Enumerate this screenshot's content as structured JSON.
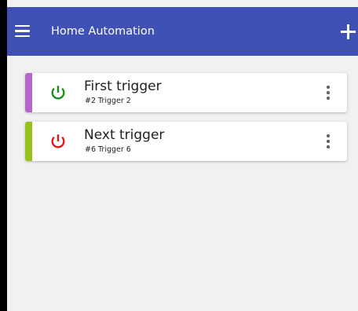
{
  "app": {
    "title": "Home Automation",
    "menu_icon": "hamburger-menu-icon",
    "add_icon": "plus-icon",
    "bar_color": "#3f51b5",
    "background_color": "#f1f1f1"
  },
  "triggers": [
    {
      "name": "First trigger",
      "subtitle": "#2 Trigger 2",
      "accent_color": "#b665c8",
      "power_state": "on",
      "power_icon": "power-icon",
      "power_color": "#1e8c1e",
      "more_icon": "more-vertical-icon"
    },
    {
      "name": "Next trigger",
      "subtitle": "#6 Trigger 6",
      "accent_color": "#97c21a",
      "power_state": "off",
      "power_icon": "power-icon",
      "power_color": "#e01818",
      "more_icon": "more-vertical-icon"
    }
  ]
}
